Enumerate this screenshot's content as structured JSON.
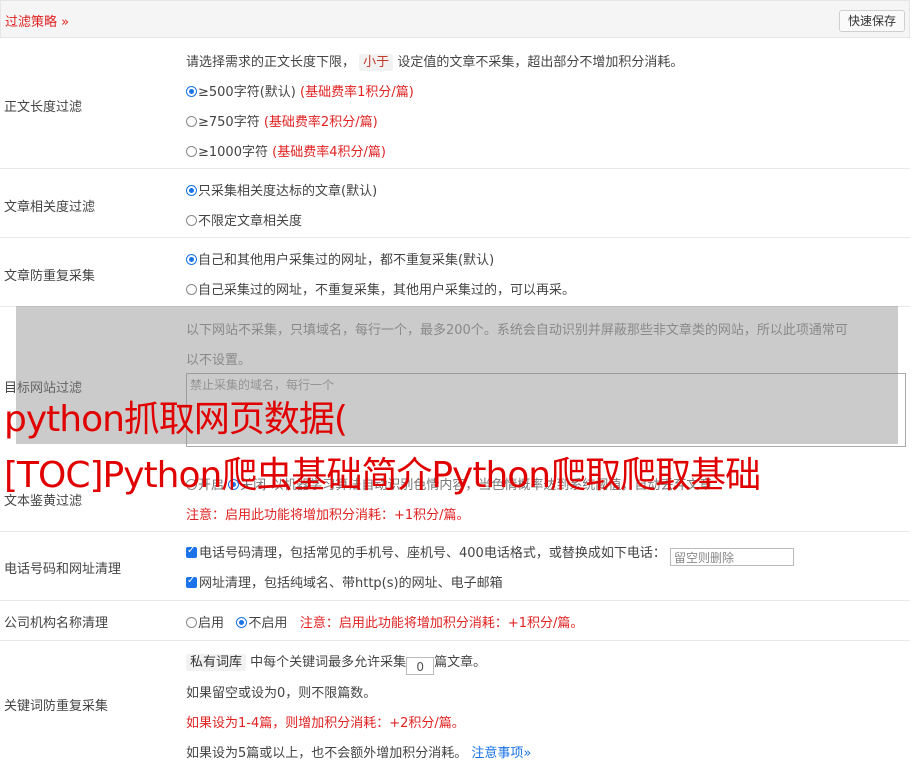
{
  "header": {
    "title": "过滤策略 »",
    "save_label": "快速保存"
  },
  "length_filter": {
    "label": "正文长度过滤",
    "desc_pre": "请选择需求的正文长度下限，",
    "desc_tag": "小于",
    "desc_post": "设定值的文章不采集，超出部分不增加积分消耗。",
    "options": [
      {
        "text": "≥500字符(默认)",
        "note": "(基础费率1积分/篇)"
      },
      {
        "text": "≥750字符",
        "note": "(基础费率2积分/篇)"
      },
      {
        "text": "≥1000字符",
        "note": "(基础费率4积分/篇)"
      }
    ]
  },
  "relevance": {
    "label": "文章相关度过滤",
    "options": [
      "只采集相关度达标的文章(默认)",
      "不限定文章相关度"
    ]
  },
  "dedup": {
    "label": "文章防重复采集",
    "options": [
      "自己和其他用户采集过的网址，都不重复采集(默认)",
      "自己采集过的网址，不重复采集，其他用户采集过的，可以再采。"
    ]
  },
  "target": {
    "label": "目标网站过滤",
    "desc1": "以下网站不采集，只填域名，每行一个，最多200个。系统会自动识别并屏蔽那些非文章类的网站，所以此项通常可",
    "desc2": "以不设置。",
    "placeholder": "禁止采集的域名，每行一个"
  },
  "porn": {
    "label": "文本鉴黄过滤",
    "opt_on": "开启",
    "opt_off": "关闭",
    "desc": "以机器学习算法自动识别色情内容，当色情概率达到系统阈值，自动丢弃文章",
    "note": "注意：启用此功能将增加积分消耗：+1积分/篇。"
  },
  "phone": {
    "label": "电话号码和网址清理",
    "phone_text": "电话号码清理，包括常见的手机号、座机号、400电话格式，或替换成如下电话：",
    "phone_placeholder": "留空则删除",
    "url_text": "网址清理，包括纯域名、带http(s)的网址、电子邮箱"
  },
  "company": {
    "label": "公司机构名称清理",
    "opt_on": "启用",
    "opt_off": "不启用",
    "note": "注意：启用此功能将增加积分消耗：+1积分/篇。"
  },
  "keyword": {
    "label": "关键词防重复采集",
    "tag": "私有词库",
    "line1_pre": "中每个关键词最多允许采集",
    "value": "0",
    "line1_post": "篇文章。",
    "line2": "如果留空或设为0，则不限篇数。",
    "line3": "如果设为1-4篇，则增加积分消耗：+2积分/篇。",
    "line4": "如果设为5篇或以上，也不会额外增加积分消耗。",
    "link": "注意事项»"
  },
  "watermark": {
    "line1": "python抓取网页数据(",
    "line2": "[TOC]Python爬虫基础简介Python爬取爬取基础"
  }
}
